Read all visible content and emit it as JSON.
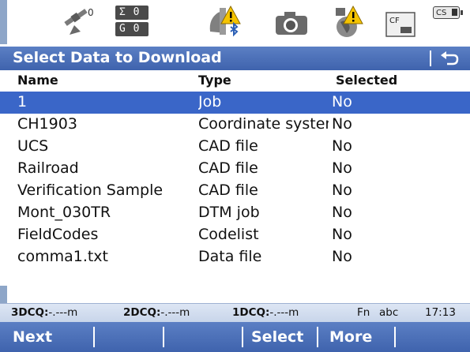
{
  "status": {
    "count_sigma": "Σ 0",
    "count_g": "G 0",
    "cf_label": "CF",
    "battery_label": "CS"
  },
  "title": "Select Data to Download",
  "columns": {
    "name": "Name",
    "type": "Type",
    "selected": "Selected"
  },
  "rows": [
    {
      "name": "1",
      "type": "Job",
      "selected": "No"
    },
    {
      "name": "CH1903",
      "type": "Coordinate system",
      "selected": "No"
    },
    {
      "name": "UCS",
      "type": "CAD file",
      "selected": "No"
    },
    {
      "name": "Railroad",
      "type": "CAD file",
      "selected": "No"
    },
    {
      "name": "Verification Sample",
      "type": "CAD file",
      "selected": "No"
    },
    {
      "name": "Mont_030TR",
      "type": "DTM job",
      "selected": "No"
    },
    {
      "name": "FieldCodes",
      "type": "Codelist",
      "selected": "No"
    },
    {
      "name": "comma1.txt",
      "type": "Data file",
      "selected": "No"
    }
  ],
  "info": {
    "q3_label": "3DCQ:",
    "q3_value": "-.---m",
    "q2_label": "2DCQ:",
    "q2_value": "-.---m",
    "q1_label": "1DCQ:",
    "q1_value": "-.---m",
    "fn": "Fn",
    "mode": "abc",
    "time": "17:13"
  },
  "softkeys": {
    "f1": "Next",
    "f2": "",
    "f3": "",
    "f4": "Select",
    "f5": "More",
    "f6": ""
  },
  "colors": {
    "accent": "#3f63ad",
    "selected_row": "#3a66c8",
    "info_bg": "#c8d5ea"
  }
}
